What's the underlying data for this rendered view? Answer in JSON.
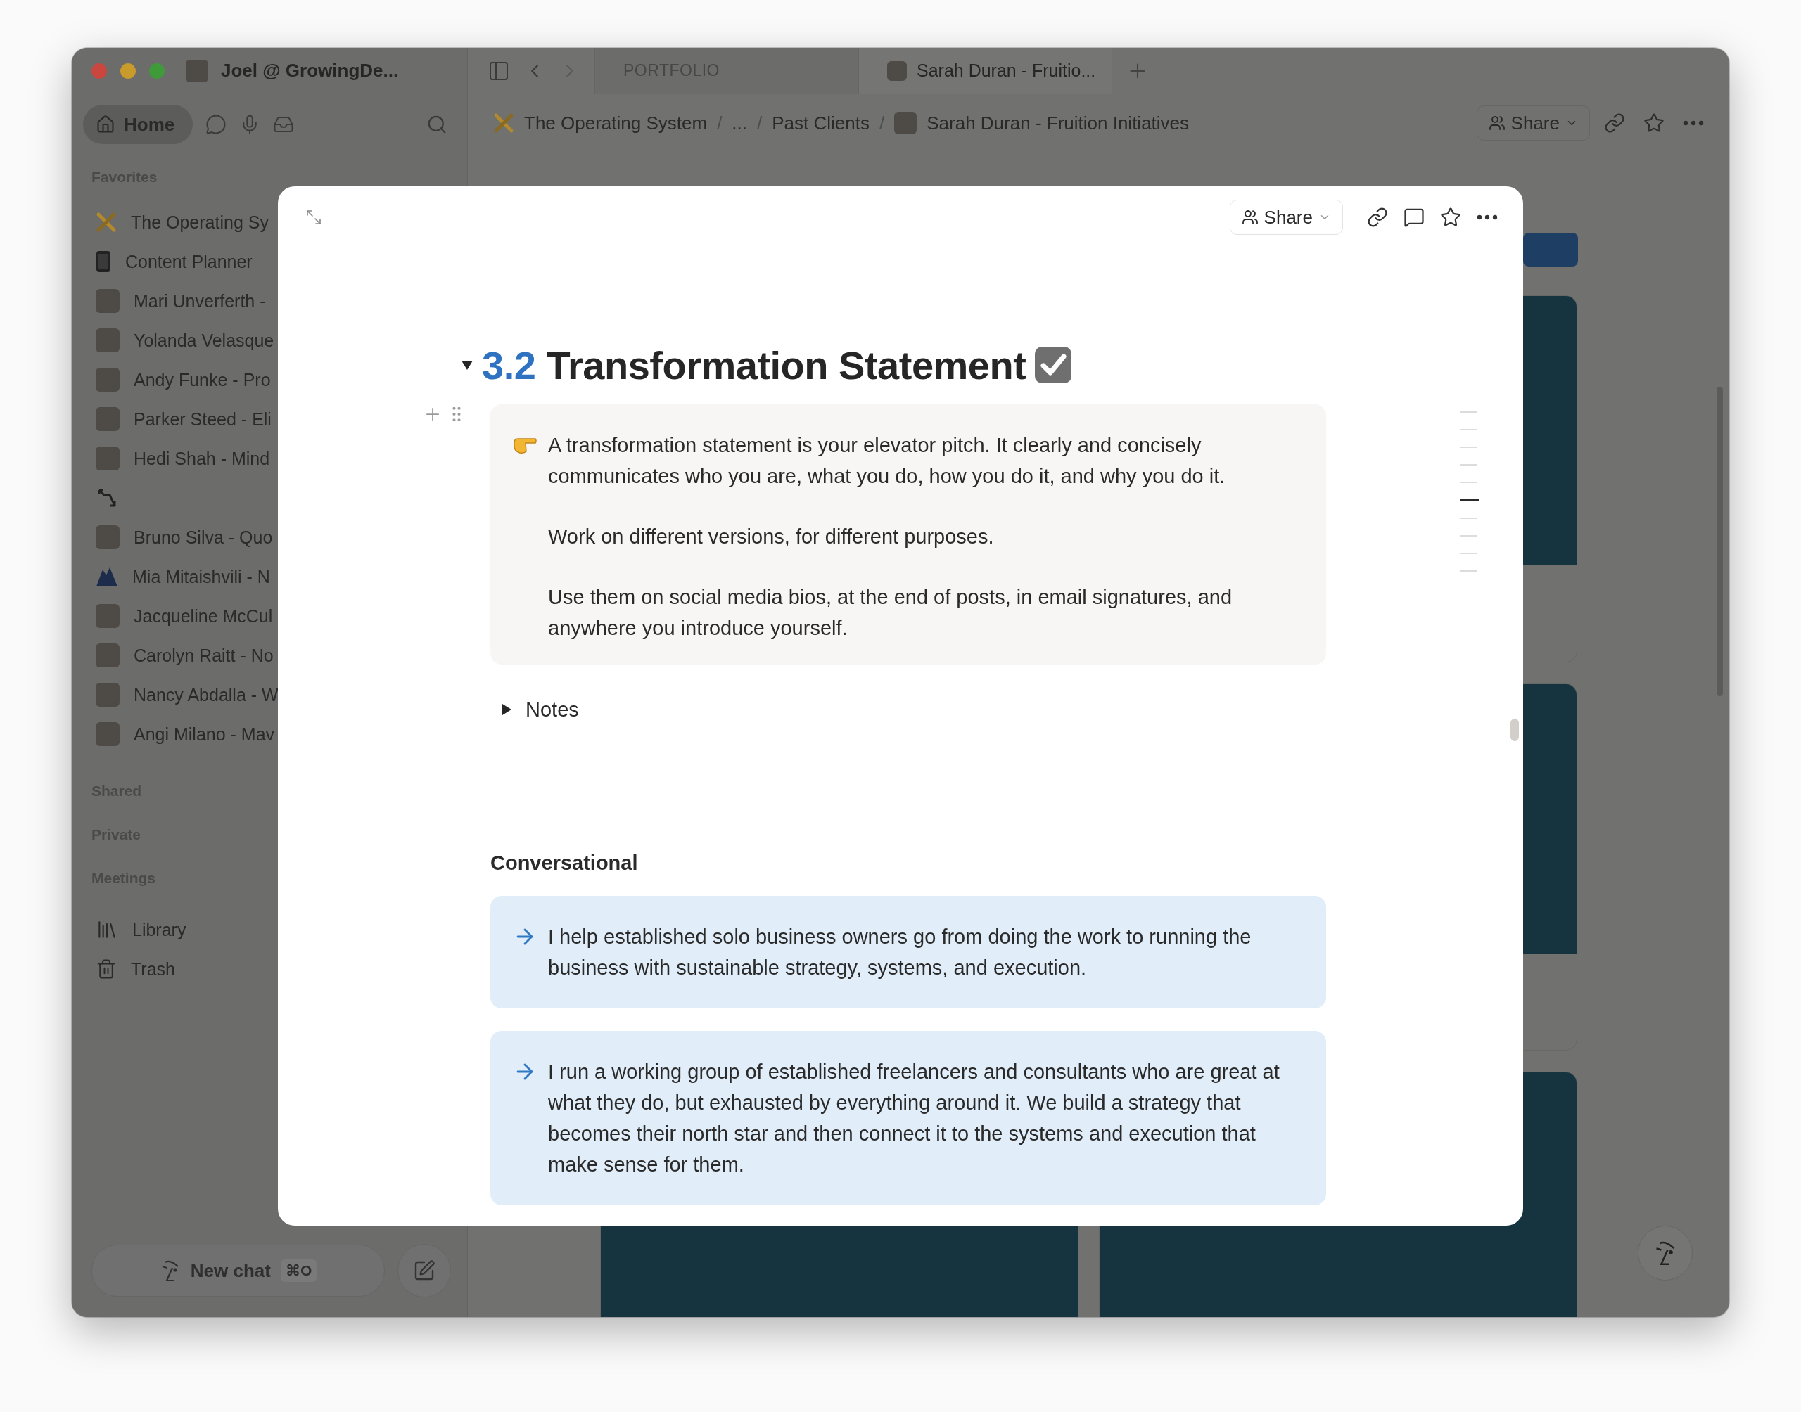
{
  "app": {
    "workspace": "Joel @ GrowingDe...",
    "tabs": [
      {
        "label": "PORTFOLIO",
        "selected": false
      },
      {
        "label": "Sarah Duran - Fruitio...",
        "selected": true
      }
    ]
  },
  "sidebar": {
    "nav": [
      {
        "label": "Home",
        "selected": true
      }
    ],
    "favorites_heading": "Favorites",
    "favorites": [
      {
        "kind": "pencils",
        "label": "The Operating Sy"
      },
      {
        "kind": "phone",
        "label": "Content Planner"
      },
      {
        "kind": "avatar",
        "label": "Mari Unverferth -"
      },
      {
        "kind": "avatar",
        "label": "Yolanda Velasque"
      },
      {
        "kind": "avatar",
        "label": "Andy Funke - Pro"
      },
      {
        "kind": "avatar",
        "label": "Parker Steed - Eli"
      },
      {
        "kind": "avatar",
        "label": "Hedi Shah - Mind"
      },
      {
        "kind": "arrows"
      },
      {
        "kind": "avatar",
        "label": "Bruno Silva - Quo"
      },
      {
        "kind": "mountain",
        "label": "Mia Mitaishvili - N"
      },
      {
        "kind": "avatar",
        "label": "Jacqueline McCul"
      },
      {
        "kind": "avatar",
        "label": "Carolyn Raitt - No"
      },
      {
        "kind": "avatar",
        "label": "Nancy Abdalla - W"
      },
      {
        "kind": "avatar",
        "label": "Angi Milano - Mav"
      }
    ],
    "sections": [
      "Shared",
      "Private",
      "Meetings"
    ],
    "links": [
      {
        "kind": "library",
        "label": "Library"
      },
      {
        "kind": "trash",
        "label": "Trash"
      }
    ],
    "new_chat": {
      "label": "New chat",
      "shortcut": "⌘O"
    }
  },
  "topbar": {
    "breadcrumbs": [
      {
        "kind": "pencils",
        "label": "The Operating System"
      },
      {
        "kind": "plain",
        "label": "..."
      },
      {
        "kind": "plain",
        "label": "Past Clients"
      },
      {
        "kind": "avatar",
        "label": "Sarah Duran - Fruition Initiatives"
      }
    ],
    "separator": "/",
    "share": "Share"
  },
  "modal": {
    "share": "Share",
    "heading": {
      "number": "3.2",
      "title": "Transformation Statement",
      "expanded": true
    },
    "callout": [
      "A transformation statement is your elevator pitch. It clearly and concisely communicates who you are, what you do, how you do it, and why you do it.",
      "Work on different versions, for different purposes.",
      "Use them on social media bios, at the end of posts, in email signatures, and anywhere you introduce yourself."
    ],
    "toggle": {
      "label": "Notes",
      "expanded": false
    },
    "subheading": "Conversational",
    "statements": [
      "I help established solo business owners go from doing the work to running the business with sustainable strategy, systems, and execution.",
      "I run a working group of established freelancers and consultants who are great at what they do, but exhausted by everything around it. We build a strategy that becomes their north star and then connect it to the systems and execution that make sense for them."
    ],
    "outline": [
      {
        "selected": false
      },
      {
        "selected": false
      },
      {
        "selected": false
      },
      {
        "selected": false
      },
      {
        "selected": false
      },
      {
        "selected": true
      },
      {
        "selected": false
      },
      {
        "selected": false
      },
      {
        "selected": false
      },
      {
        "selected": false
      }
    ]
  }
}
